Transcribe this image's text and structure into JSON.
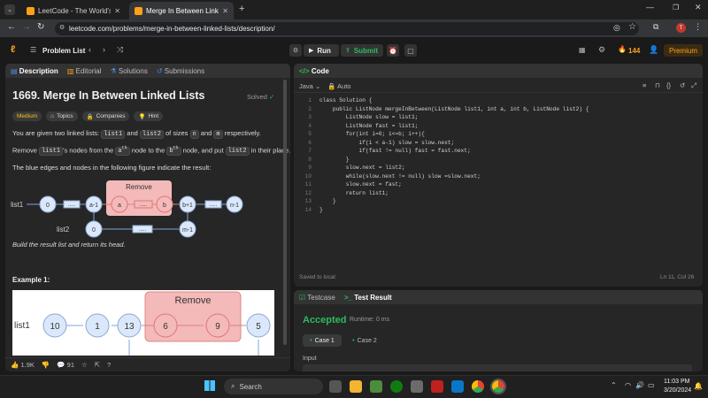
{
  "browser": {
    "tabs": [
      {
        "title": "LeetCode - The World's Leadin",
        "active": false
      },
      {
        "title": "Merge In Between Linked Lists",
        "active": true
      }
    ],
    "url": "leetcode.com/problems/merge-in-between-linked-lists/description/"
  },
  "nav": {
    "problem_list": "Problem List",
    "run": "Run",
    "submit": "Submit",
    "streak": "144",
    "premium": "Premium"
  },
  "left_tabs": [
    "Description",
    "Editorial",
    "Solutions",
    "Submissions"
  ],
  "problem": {
    "title": "1669. Merge In Between Linked Lists",
    "status": "Solved",
    "tags": [
      "Medium",
      "Topics",
      "Companies",
      "Hint"
    ],
    "p1_pre": "You are given two linked lists: ",
    "p1_c1": "list1",
    "p1_mid": " and ",
    "p1_c2": "list2",
    "p1_sz": " of sizes ",
    "p1_n": "n",
    "p1_and": " and ",
    "p1_m": "m",
    "p1_post": " respectively.",
    "p2_pre": "Remove ",
    "p2_c1": "list1",
    "p2_a": "'s nodes from the ",
    "p2_ath": "a",
    "p2_th": "th",
    "p2_node": " node to the ",
    "p2_bth": "b",
    "p2_th2": "th",
    "p2_put": " node, and put ",
    "p2_c2": "list2",
    "p2_post": " in their place.",
    "p3": "The blue edges and nodes in the following figure indicate the result:",
    "fig1": {
      "remove": "Remove",
      "list1": "list1",
      "list2": "list2",
      "nodes1": [
        "0",
        ".....",
        "a-1",
        "a",
        ".....",
        "b",
        "b+1",
        ".....",
        "n-1"
      ],
      "nodes2": [
        "0",
        ".....",
        "m-1"
      ]
    },
    "caption": "Build the result list and return its head.",
    "example": "Example 1:",
    "fig2": {
      "remove": "Remove",
      "list1": "list1",
      "nodes": [
        "10",
        "1",
        "13",
        "6",
        "9",
        "5"
      ]
    },
    "likes": "1.9K",
    "comments": "91"
  },
  "editor": {
    "title": "Code",
    "lang": "Java",
    "auto": "Auto",
    "lines": [
      "class Solution {",
      "    public ListNode mergeInBetween(ListNode list1, int a, int b, ListNode list2) {",
      "        ListNode slow = list1;",
      "        ListNode fast = list1;",
      "        for(int i=0; i<=b; i++){",
      "            if(i < a-1) slow = slow.next;",
      "            if(fast != null) fast = fast.next;",
      "        }",
      "        slow.next = list2;",
      "        while(slow.next != null) slow =slow.next;",
      "        slow.next = fast;",
      "        return list1;",
      "    }",
      "}"
    ],
    "saved": "Saved to local",
    "cursor": "Ln 11, Col 26"
  },
  "result": {
    "tabs": [
      "Testcase",
      "Test Result"
    ],
    "status": "Accepted",
    "runtime": "Runtime: 0 ms",
    "cases": [
      "Case 1",
      "Case 2"
    ],
    "input_label": "Input"
  },
  "taskbar": {
    "search": "Search",
    "time": "11:03 PM",
    "date": "3/20/2024"
  },
  "colors": {
    "accepted": "#2cbb5d",
    "medium": "#ffc01e",
    "submit": "#2cbb5d",
    "premium": "#ffa116",
    "node_fill": "#dbe8fb",
    "remove_fill": "#f4b9b9"
  }
}
